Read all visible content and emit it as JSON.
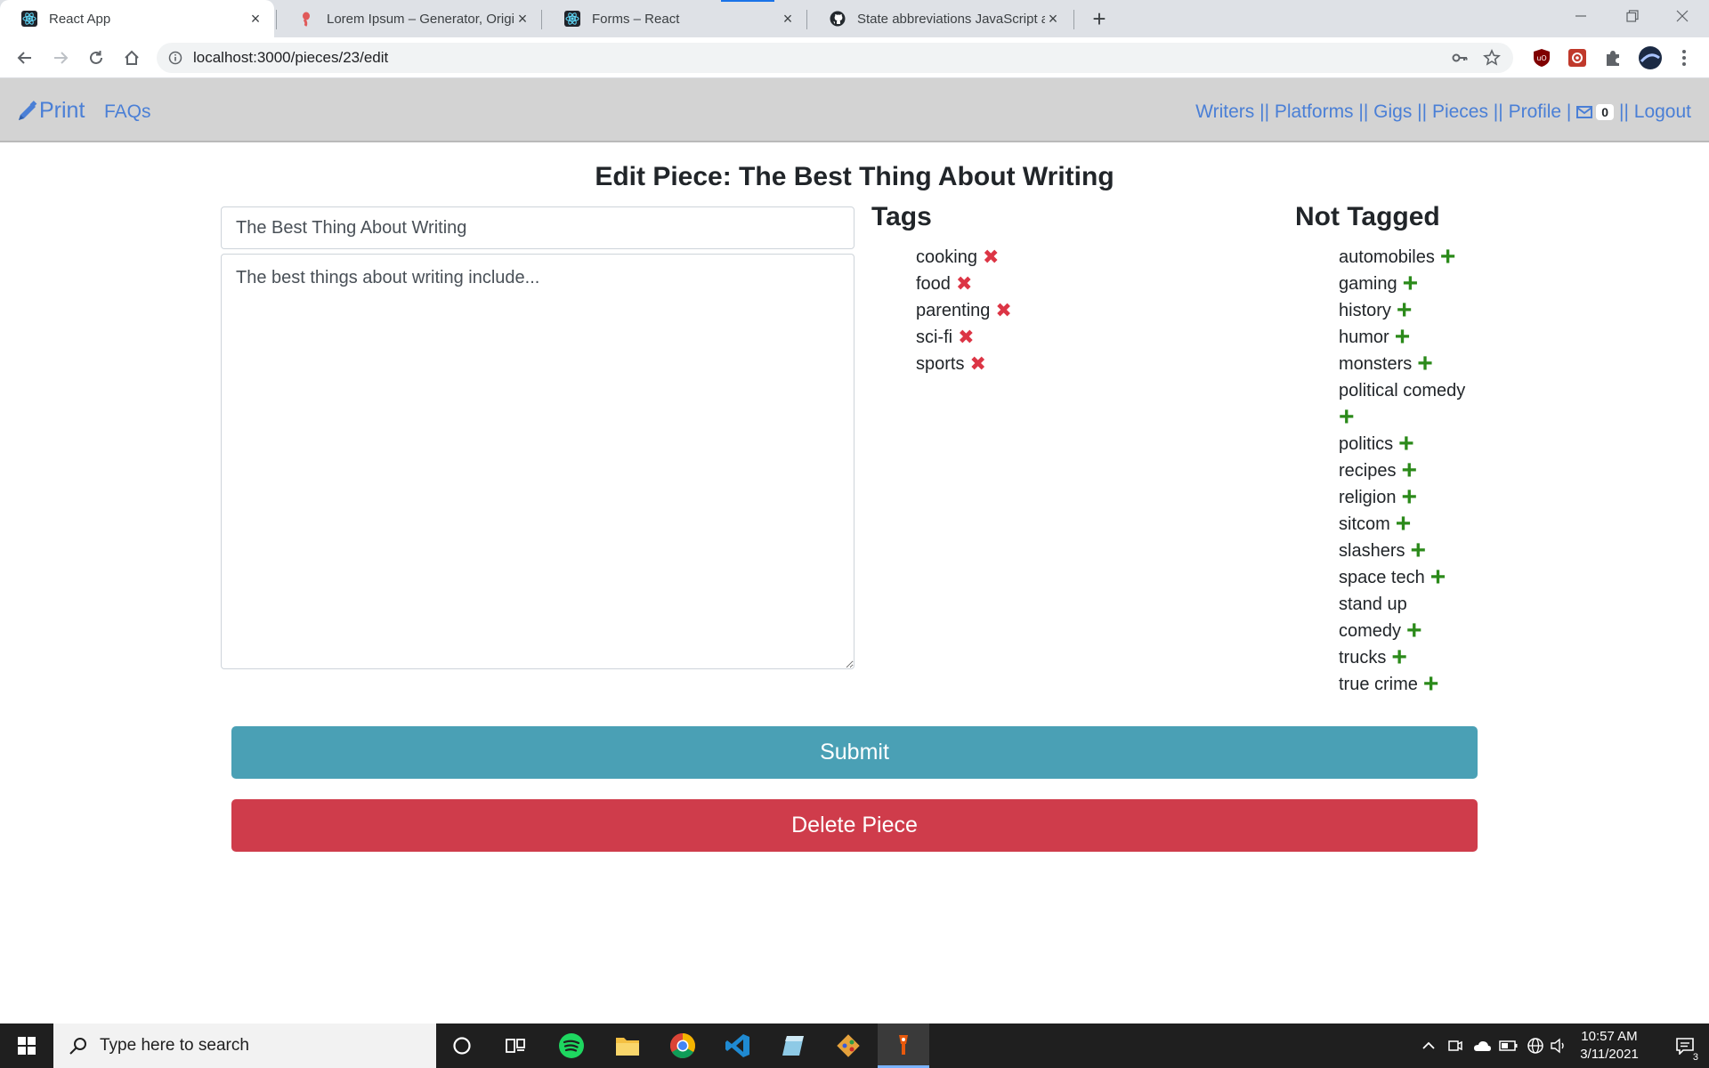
{
  "browser": {
    "tabs": [
      {
        "title": "React App",
        "icon": "react-icon"
      },
      {
        "title": "Lorem Ipsum – Generator, Origins and Meaning",
        "icon": "lorem-icon"
      },
      {
        "title": "Forms – React",
        "icon": "react-icon"
      },
      {
        "title": "State abbreviations JavaScript array",
        "icon": "github-icon"
      }
    ],
    "url": "localhost:3000/pieces/23/edit"
  },
  "appnav": {
    "brand": "Print",
    "faqs": "FAQs",
    "links": {
      "writers": "Writers",
      "platforms": "Platforms",
      "gigs": "Gigs",
      "pieces": "Pieces",
      "profile": "Profile",
      "logout": "Logout"
    },
    "sep_double": " || ",
    "sep_single": " | ",
    "sep_after_badge": "|| ",
    "message_count": "0"
  },
  "page": {
    "title": "Edit Piece: The Best Thing About Writing",
    "title_value": "The Best Thing About Writing",
    "body_value": "The best things about writing include...",
    "tags_heading": "Tags",
    "not_tagged_heading": "Not Tagged",
    "tags": [
      "cooking",
      "food",
      "parenting",
      "sci-fi",
      "sports"
    ],
    "not_tagged": [
      "automobiles",
      "gaming",
      "history",
      "humor",
      "monsters",
      "political comedy",
      "politics",
      "recipes",
      "religion",
      "sitcom",
      "slashers",
      "space tech",
      "stand up comedy",
      "trucks",
      "true crime"
    ],
    "submit_label": "Submit",
    "delete_label": "Delete Piece",
    "colors": {
      "submit": "#4aa0b5",
      "delete": "#cf3c4b",
      "remove_icon": "#dc3545",
      "add_icon": "#2b8a1a",
      "link": "#4a7fd6"
    }
  },
  "taskbar": {
    "search_placeholder": "Type here to search",
    "time": "10:57 AM",
    "date": "3/11/2021",
    "notification_count": "3"
  }
}
